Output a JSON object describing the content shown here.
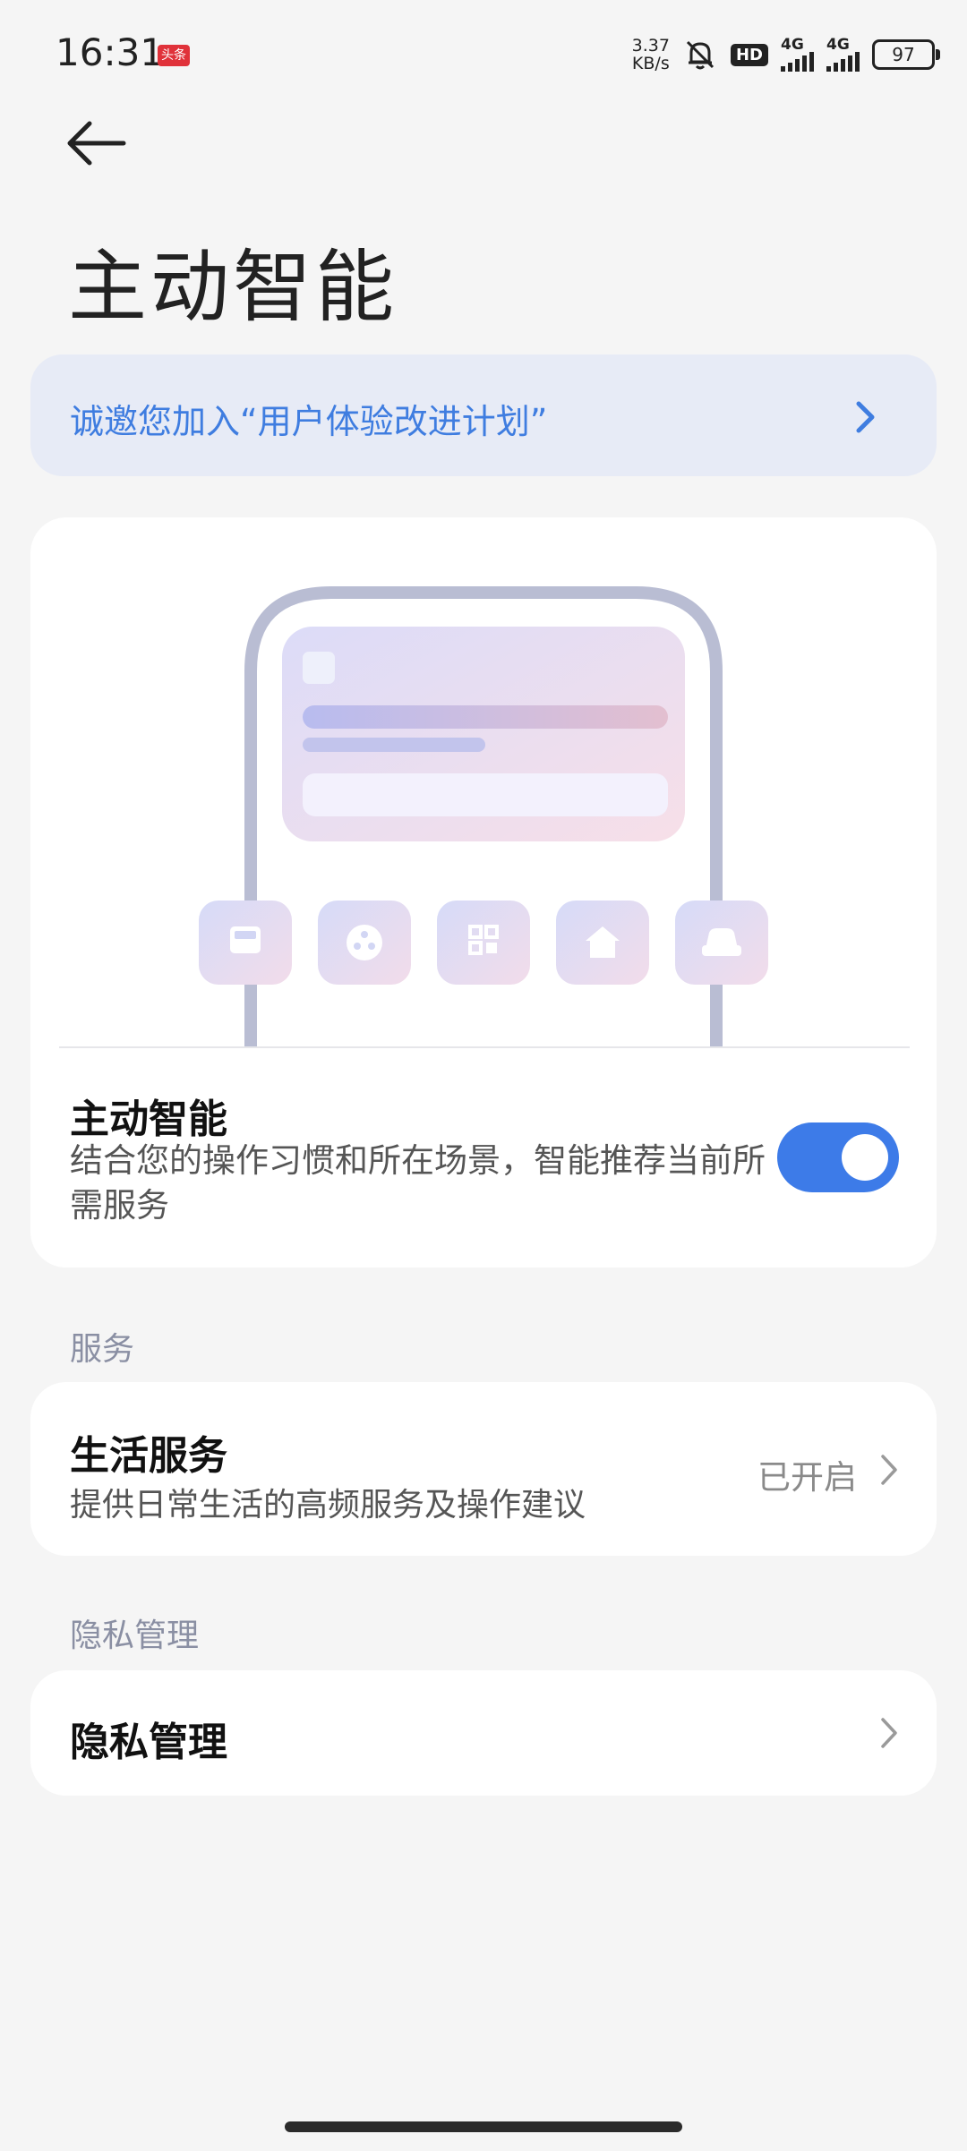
{
  "status_bar": {
    "time": "16:31",
    "app_badge": "头条",
    "net_speed_value": "3.37",
    "net_speed_unit": "KB/s",
    "hd_label": "HD",
    "net1_label": "4G",
    "net2_label": "4G",
    "battery": "97"
  },
  "header": {
    "back_icon": "arrow-left-icon",
    "title": "主动智能"
  },
  "banner": {
    "text": "诚邀您加入“用户体验改进计划”",
    "chevron_color": "#3f7de0"
  },
  "smart": {
    "illustration_icons": [
      "bus-icon",
      "film-reel-icon",
      "qr-code-icon",
      "home-icon",
      "car-icon"
    ],
    "title": "主动智能",
    "description": "结合您的操作习惯和所在场景，智能推荐当前所需服务",
    "toggle_on": true,
    "toggle_color": "#3d7be8"
  },
  "services": {
    "section_label": "服务",
    "item_title": "生活服务",
    "item_desc": "提供日常生活的高频服务及操作建议",
    "item_status": "已开启"
  },
  "privacy": {
    "section_label": "隐私管理",
    "item_title": "隐私管理"
  }
}
